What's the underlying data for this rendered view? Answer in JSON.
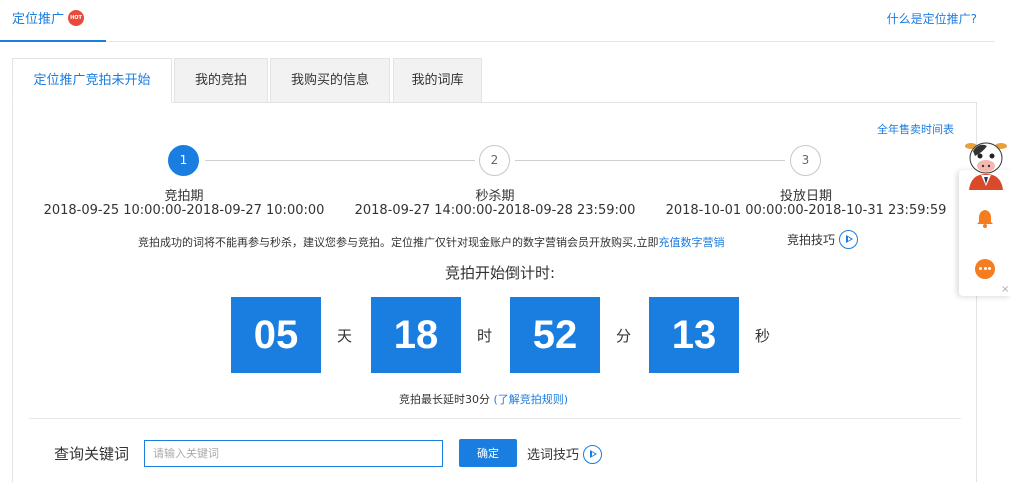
{
  "header": {
    "title": "定位推广",
    "hot_badge": "HOT",
    "help_link": "什么是定位推广?"
  },
  "tabs": [
    {
      "label": "定位推广竞拍未开始",
      "active": true
    },
    {
      "label": "我的竞拍",
      "active": false
    },
    {
      "label": "我购买的信息",
      "active": false
    },
    {
      "label": "我的词库",
      "active": false
    }
  ],
  "year_table_link": "全年售卖时间表",
  "steps": [
    {
      "number": "1",
      "name": "竞拍期",
      "date": "2018-09-25 10:00:00-2018-09-27 10:00:00",
      "active": true
    },
    {
      "number": "2",
      "name": "秒杀期",
      "date": "2018-09-27 14:00:00-2018-09-28 23:59:00",
      "active": false
    },
    {
      "number": "3",
      "name": "投放日期",
      "date": "2018-10-01 00:00:00-2018-10-31 23:59:59",
      "active": false
    }
  ],
  "notice": {
    "text": "竞拍成功的词将不能再参与秒杀，建议您参与竞拍。定位推广仅针对现金账户的数字营销会员开放购买,立即",
    "link": "充值数字营销",
    "tips": "竞拍技巧"
  },
  "countdown": {
    "title": "竞拍开始倒计时:",
    "days": "05",
    "days_unit": "天",
    "hours": "18",
    "hours_unit": "时",
    "minutes": "52",
    "minutes_unit": "分",
    "seconds": "13",
    "seconds_unit": "秒"
  },
  "delay": {
    "text": "竞拍最长延时30分",
    "link": "(了解竞拍规则)"
  },
  "query": {
    "label": "查询关键词",
    "placeholder": "请输入关键词",
    "value": "",
    "confirm_label": "确定",
    "tips": "选词技巧"
  },
  "float_widget": {
    "close": "×"
  },
  "colors": {
    "accent": "#1a7de0",
    "hot": "#e84b3c",
    "bell": "#f57c1f"
  }
}
